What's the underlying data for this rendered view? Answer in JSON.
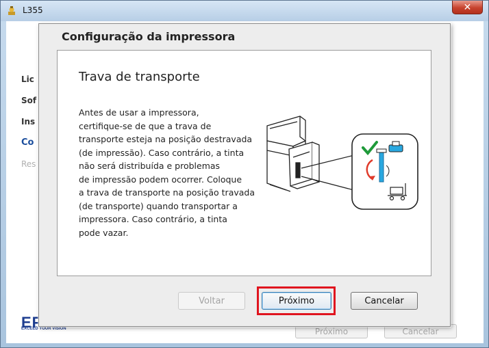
{
  "window": {
    "title": "L355",
    "close_glyph": "✕"
  },
  "sidebar": {
    "items": [
      {
        "label": "Lic"
      },
      {
        "label": "Sof"
      },
      {
        "label": "Ins"
      },
      {
        "label": "Co"
      },
      {
        "label": "Res"
      }
    ]
  },
  "branding": {
    "logo": "EP",
    "tagline": "EXCEED YOUR VISION"
  },
  "outer_buttons": {
    "next_label": "Próximo",
    "cancel_label": "Cancelar"
  },
  "dialog": {
    "title": "Configuração da impressora",
    "section_title": "Trava de transporte",
    "body": "Antes de usar a impressora,\ncertifique-se de que a trava de\ntransporte esteja na posição destravada\n(de impressão). Caso contrário, a tinta\nnão será distribuída e problemas\nde impressão podem ocorrer. Coloque\na trava de transporte na posição travada\n(de transporte) quando transportar a\nimpressora. Caso contrário, a tinta\npode vazar.",
    "buttons": {
      "back_label": "Voltar",
      "next_label": "Próximo",
      "cancel_label": "Cancelar"
    }
  },
  "colors": {
    "highlight": "#e0141e",
    "check": "#1f9a3a",
    "lock_blue": "#29a8e0"
  }
}
